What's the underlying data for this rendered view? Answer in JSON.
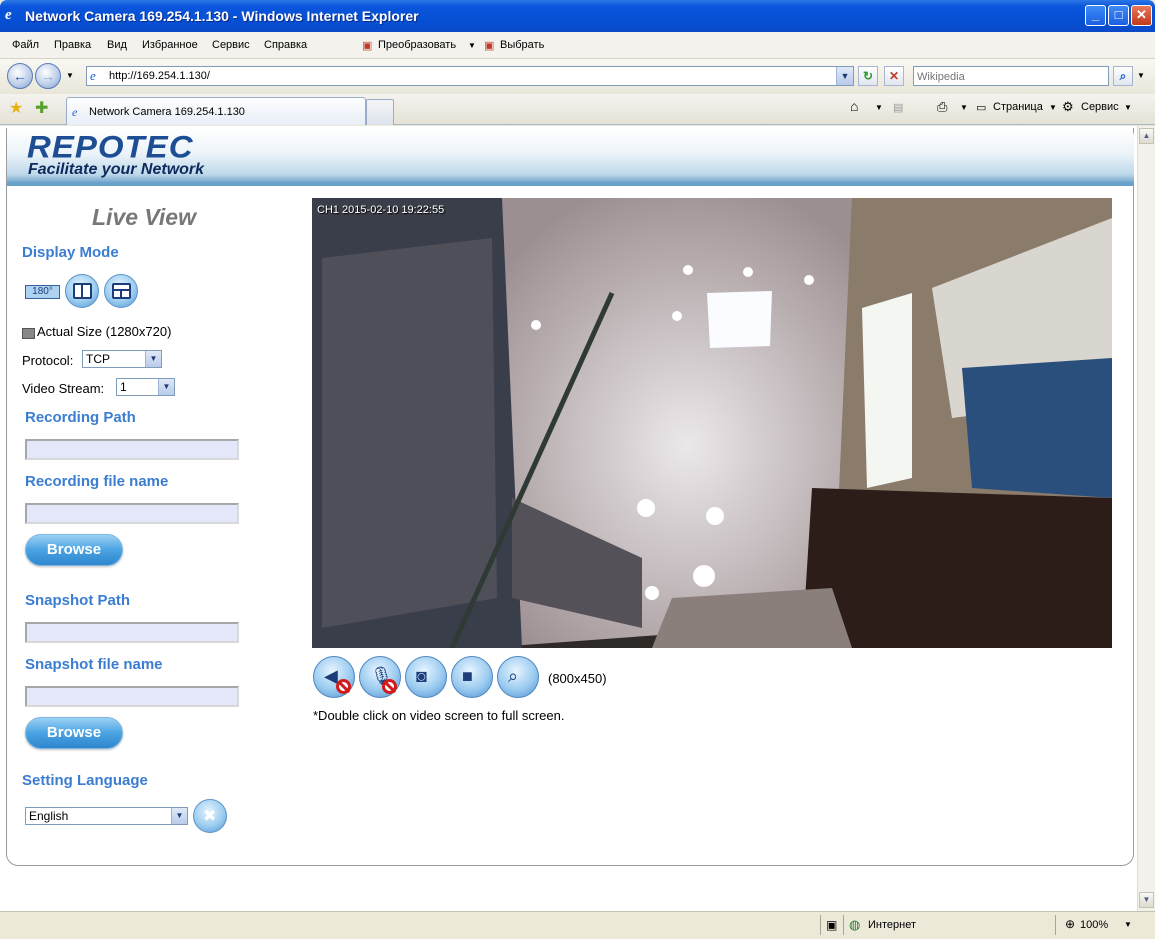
{
  "window": {
    "title": "Network Camera 169.254.1.130 - Windows Internet Explorer"
  },
  "menubar": {
    "items": [
      "Файл",
      "Правка",
      "Вид",
      "Избранное",
      "Сервис",
      "Справка"
    ],
    "convert_label": "Преобразовать",
    "select_label": "Выбрать"
  },
  "address": {
    "url": "http://169.254.1.130/",
    "search_placeholder": "Wikipedia"
  },
  "tabs": {
    "active_label": "Network Camera 169.254.1.130"
  },
  "toolbar": {
    "page_label": "Страница",
    "tools_label": "Сервис"
  },
  "header": {
    "logo_text": "REPOTEC",
    "logo_tagline": "Facilitate your Network"
  },
  "sidebar": {
    "title": "Live View",
    "display_mode_heading": "Display Mode",
    "mode_180_label": "180°",
    "actual_size_label": "Actual Size (1280x720)",
    "protocol_label": "Protocol:",
    "protocol_value": "TCP",
    "video_stream_label": "Video Stream:",
    "video_stream_value": "1",
    "recording_path_heading": "Recording Path",
    "recording_file_heading": "Recording file name",
    "browse_label": "Browse",
    "snapshot_path_heading": "Snapshot Path",
    "snapshot_file_heading": "Snapshot file name",
    "setting_language_heading": "Setting Language",
    "language_value": "English"
  },
  "video": {
    "osd_text": "CH1 2015-02-10 19:22:55",
    "resolution_label": "(800x450)",
    "hint": "*Double click on video screen to full screen."
  },
  "statusbar": {
    "zone_label": "Интернет",
    "zoom_label": "100%"
  },
  "colors": {
    "heading_blue": "#3b7dd1",
    "logo_blue": "#1d4e93",
    "title_blue": "#0550d4"
  }
}
